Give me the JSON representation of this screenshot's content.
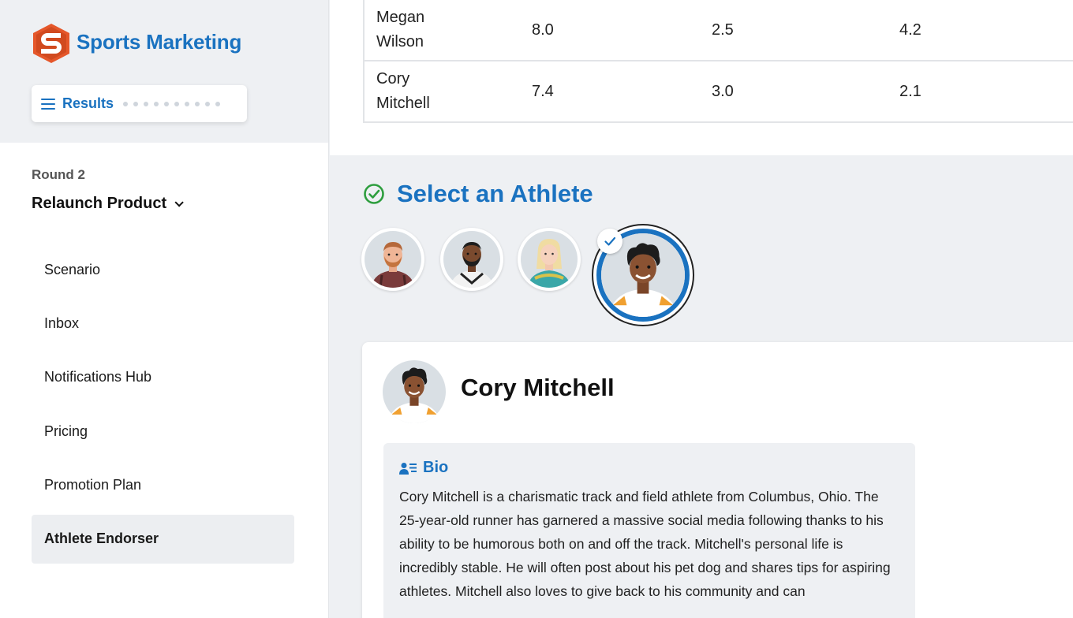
{
  "app": {
    "brand": "Sports Marketing",
    "brand_color": "#1a72c0",
    "logo_icon": "s-hexagon-logo"
  },
  "results": {
    "label": "Results",
    "icon": "hamburger-menu-icon"
  },
  "sidebar": {
    "round": "Round 2",
    "phase": "Relaunch Product",
    "items": [
      {
        "label": "Scenario",
        "active": false
      },
      {
        "label": "Inbox",
        "active": false
      },
      {
        "label": "Notifications Hub",
        "active": false
      },
      {
        "label": "Pricing",
        "active": false
      },
      {
        "label": "Promotion Plan",
        "active": false
      },
      {
        "label": "Athlete Endorser",
        "active": true
      }
    ]
  },
  "table": {
    "rows": [
      {
        "name_first": "Megan",
        "name_last": "Wilson",
        "v1": "8.0",
        "v2": "2.5",
        "v3": "4.2"
      },
      {
        "name_first": "Cory",
        "name_last": "Mitchell",
        "v1": "7.4",
        "v2": "3.0",
        "v3": "2.1"
      }
    ]
  },
  "select": {
    "title": "Select an Athlete",
    "check_color": "#2e9e3e",
    "athletes": [
      {
        "name": "athlete-1",
        "selected": false
      },
      {
        "name": "athlete-2",
        "selected": false
      },
      {
        "name": "athlete-3",
        "selected": false
      },
      {
        "name": "Cory Mitchell",
        "selected": true
      }
    ]
  },
  "card": {
    "name": "Cory Mitchell",
    "bio_title": "Bio",
    "bio_text": "Cory Mitchell is a charismatic track and field athlete from Columbus, Ohio. The 25-year-old runner has garnered a massive social media following thanks to his ability to be humorous both on and off the track. Mitchell's personal life is incredibly stable. He will often post about his pet dog and shares tips for aspiring athletes. Mitchell also loves to give back to his community and can"
  }
}
